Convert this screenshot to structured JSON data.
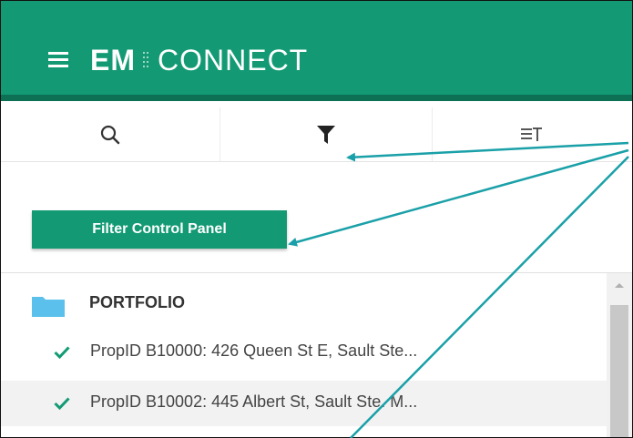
{
  "app": {
    "logo_left": "EM",
    "logo_right": "CONNECT",
    "brand_color": "#139a74",
    "brand_dark": "#0d6f53"
  },
  "header": {
    "menu_icon": "hamburger-menu-icon"
  },
  "toolbar": {
    "search_icon": "search-icon",
    "filter_icon": "funnel-filter-icon",
    "sort_icon": "sort-icon"
  },
  "filter_button": {
    "label": "Filter Control Panel"
  },
  "tree": {
    "root": {
      "label": "PORTFOLIO",
      "icon": "folder-icon",
      "icon_color": "#5bc0eb"
    },
    "items": [
      {
        "label": "PropID B10000: 426 Queen St E, Sault Ste...",
        "icon": "check-icon"
      },
      {
        "label": "PropID B10002: 445 Albert St, Sault Ste. M...",
        "icon": "check-icon"
      }
    ],
    "check_color": "#139a74"
  },
  "annotation": {
    "arrow_color": "#1aa0a8"
  }
}
